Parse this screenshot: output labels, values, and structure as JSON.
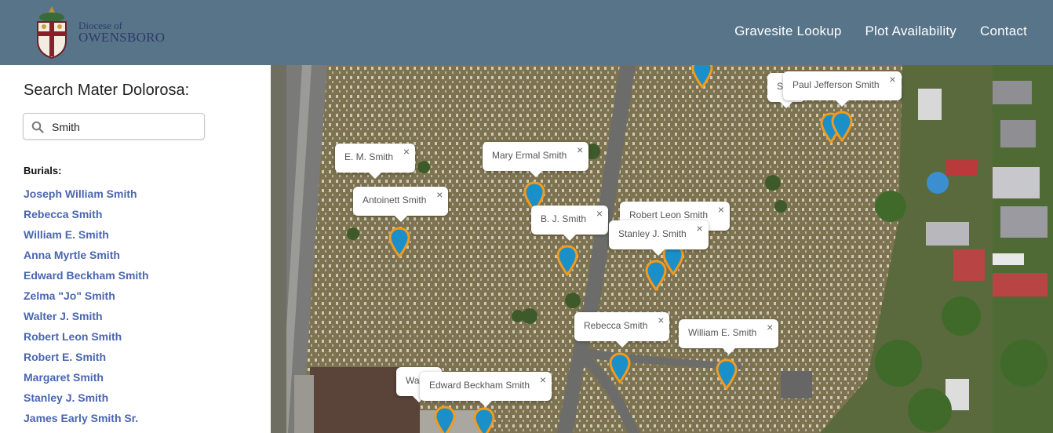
{
  "header": {
    "logo_line1": "Diocese of",
    "logo_line2": "OWENSBORO",
    "nav": [
      "Gravesite Lookup",
      "Plot Availability",
      "Contact"
    ]
  },
  "sidebar": {
    "title": "Search Mater Dolorosa:",
    "search_value": "Smith",
    "burials_heading": "Burials:",
    "burials": [
      "Joseph William Smith",
      "Rebecca Smith",
      "William E. Smith",
      "Anna Myrtle Smith",
      "Edward Beckham Smith",
      "Zelma \"Jo\" Smith",
      "Walter J. Smith",
      "Robert Leon Smith",
      "Robert E. Smith",
      "Margaret Smith",
      "Stanley J. Smith",
      "James Early Smith Sr."
    ]
  },
  "map": {
    "close_glyph": "×",
    "popups": [
      {
        "label": "E. M. Smith"
      },
      {
        "label": "Antoinett Smith"
      },
      {
        "label": "Mary Ermal Smith"
      },
      {
        "label": "B. J. Smith"
      },
      {
        "label": "Robert Leon Smith"
      },
      {
        "label": "Stanley J. Smith"
      },
      {
        "label": "Paul Jefferson Smith"
      },
      {
        "label": "S"
      },
      {
        "label": "Rebecca Smith"
      },
      {
        "label": "William E. Smith"
      },
      {
        "label": "Edward Beckham Smith"
      },
      {
        "label": "Wa"
      }
    ]
  },
  "colors": {
    "header_bg": "#587488",
    "link": "#4a66b0",
    "pin_fill": "#1b8fc7",
    "pin_stroke": "#f29a1f"
  }
}
